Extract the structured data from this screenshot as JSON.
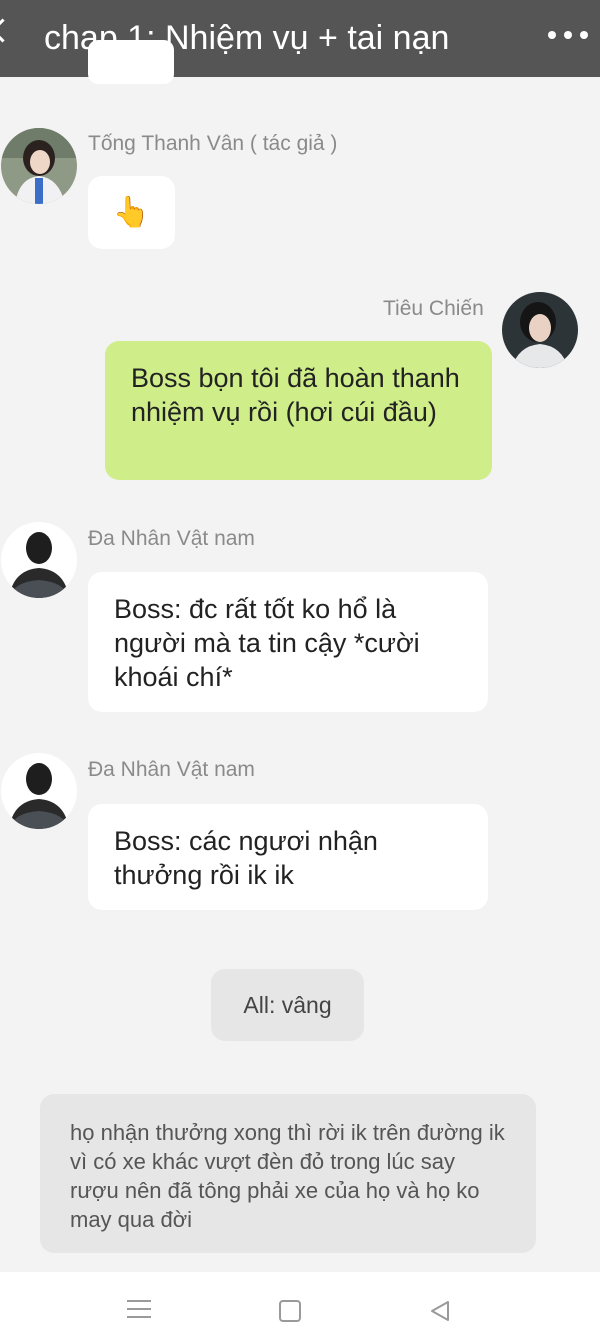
{
  "header": {
    "title": "chap 1: Nhiệm vụ + tai nạn",
    "back_icon": "chevron-left-icon",
    "menu_icon": "more-dots-icon"
  },
  "messages": [
    {
      "sender": "Tống Thanh Vân ( tác giả )",
      "text": "👆",
      "side": "left"
    },
    {
      "sender": "Tiêu Chiến",
      "text": "Boss bọn tôi đã hoàn thanh nhiệm vụ rồi (hơi cúi đầu)",
      "side": "right"
    },
    {
      "sender": "Đa Nhân Vật nam",
      "text": "Boss: đc rất tốt ko hổ là người mà ta tin cậy *cười khoái chí*",
      "side": "left"
    },
    {
      "sender": "Đa Nhân Vật nam",
      "text": "Boss: các ngươi nhận thưởng rồi ik ik",
      "side": "left"
    }
  ],
  "center_message": "All: vâng",
  "narration": "họ nhận thưởng xong thì rời ik trên đường ik vì có xe khác vượt đèn đỏ trong lúc say rượu nên đã tông phải xe của họ và họ ko may qua đời",
  "colors": {
    "topbar": "#555555",
    "my_bubble": "#cfee8a",
    "other_bubble": "#ffffff",
    "background": "#f3f3f3"
  },
  "navbar": {
    "icons": [
      "menu-icon",
      "home-square-icon",
      "back-triangle-icon"
    ]
  }
}
